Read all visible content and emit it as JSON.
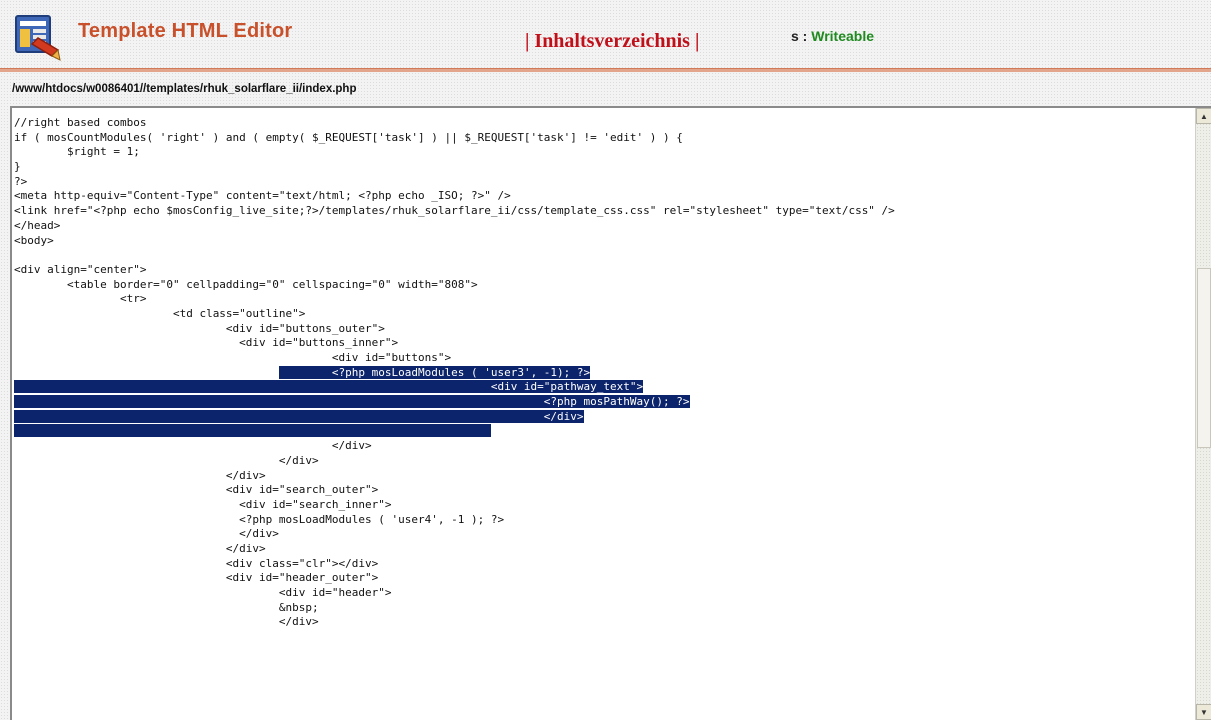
{
  "header": {
    "title": "Template HTML Editor",
    "toc_link": "| Inhaltsverzeichnis |",
    "status_key": "s :",
    "status_value": "Writeable",
    "logo_icon": "template-editor-icon"
  },
  "colors": {
    "title": "#c8502a",
    "toc_link": "#c0101a",
    "status_value": "#1f8a1f",
    "selection": "#0c246b"
  },
  "file": {
    "path": "/www/htdocs/w0086401//templates/rhuk_solarflare_ii/index.php"
  },
  "editor": {
    "scroll_up_icon": "scroll-up-arrow-icon",
    "scroll_down_icon": "scroll-down-arrow-icon",
    "lines": [
      {
        "indent": "",
        "text": "//right based combos",
        "sel_pre": "",
        "sel_text": ""
      },
      {
        "indent": "",
        "text": "if ( mosCountModules( 'right' ) and ( empty( $_REQUEST['task'] ) || $_REQUEST['task'] != 'edit' ) ) {",
        "sel_pre": "",
        "sel_text": ""
      },
      {
        "indent": "        ",
        "text": "$right = 1;",
        "sel_pre": "",
        "sel_text": ""
      },
      {
        "indent": "",
        "text": "}",
        "sel_pre": "",
        "sel_text": ""
      },
      {
        "indent": "",
        "text": "?>",
        "sel_pre": "",
        "sel_text": ""
      },
      {
        "indent": "",
        "text": "<meta http-equiv=\"Content-Type\" content=\"text/html; <?php echo _ISO; ?>\" />",
        "sel_pre": "",
        "sel_text": ""
      },
      {
        "indent": "",
        "text": "<link href=\"<?php echo $mosConfig_live_site;?>/templates/rhuk_solarflare_ii/css/template_css.css\" rel=\"stylesheet\" type=\"text/css\" />",
        "sel_pre": "",
        "sel_text": ""
      },
      {
        "indent": "",
        "text": "</head>",
        "sel_pre": "",
        "sel_text": ""
      },
      {
        "indent": "",
        "text": "<body>",
        "sel_pre": "",
        "sel_text": ""
      },
      {
        "indent": "",
        "text": "",
        "sel_pre": "",
        "sel_text": ""
      },
      {
        "indent": "",
        "text": "<div align=\"center\">",
        "sel_pre": "",
        "sel_text": ""
      },
      {
        "indent": "        ",
        "text": "<table border=\"0\" cellpadding=\"0\" cellspacing=\"0\" width=\"808\">",
        "sel_pre": "",
        "sel_text": ""
      },
      {
        "indent": "                ",
        "text": "<tr>",
        "sel_pre": "",
        "sel_text": ""
      },
      {
        "indent": "                        ",
        "text": "<td class=\"outline\">",
        "sel_pre": "",
        "sel_text": ""
      },
      {
        "indent": "                                ",
        "text": "<div id=\"buttons_outer\">",
        "sel_pre": "",
        "sel_text": ""
      },
      {
        "indent": "                                  ",
        "text": "<div id=\"buttons_inner\">",
        "sel_pre": "",
        "sel_text": ""
      },
      {
        "indent": "                                                ",
        "text": "<div id=\"buttons\">",
        "sel_pre": "",
        "sel_text": ""
      },
      {
        "indent": "                                        ",
        "text": "",
        "sel_pre": "        ",
        "sel_text": "<?php mosLoadModules ( 'user3', -1); ?>"
      },
      {
        "indent": "",
        "text": "",
        "sel_pre": "",
        "sel_text": "                                                                        <div id=\"pathway_text\">"
      },
      {
        "indent": "",
        "text": "",
        "sel_pre": "",
        "sel_text": "                                                                                <?php mosPathWay(); ?>"
      },
      {
        "indent": "",
        "text": "",
        "sel_pre": "",
        "sel_text": "                                                                                </div>"
      },
      {
        "indent": "",
        "text": "",
        "sel_pre": "",
        "sel_text": "                                                                        "
      },
      {
        "indent": "                                                ",
        "text": "</div>",
        "sel_pre": "",
        "sel_text": ""
      },
      {
        "indent": "                                        ",
        "text": "</div>",
        "sel_pre": "",
        "sel_text": ""
      },
      {
        "indent": "                                ",
        "text": "</div>",
        "sel_pre": "",
        "sel_text": ""
      },
      {
        "indent": "                                ",
        "text": "<div id=\"search_outer\">",
        "sel_pre": "",
        "sel_text": ""
      },
      {
        "indent": "                                  ",
        "text": "<div id=\"search_inner\">",
        "sel_pre": "",
        "sel_text": ""
      },
      {
        "indent": "                                  ",
        "text": "<?php mosLoadModules ( 'user4', -1 ); ?>",
        "sel_pre": "",
        "sel_text": ""
      },
      {
        "indent": "                                  ",
        "text": "</div>",
        "sel_pre": "",
        "sel_text": ""
      },
      {
        "indent": "                                ",
        "text": "</div>",
        "sel_pre": "",
        "sel_text": ""
      },
      {
        "indent": "                                ",
        "text": "<div class=\"clr\"></div>",
        "sel_pre": "",
        "sel_text": ""
      },
      {
        "indent": "                                ",
        "text": "<div id=\"header_outer\">",
        "sel_pre": "",
        "sel_text": ""
      },
      {
        "indent": "                                        ",
        "text": "<div id=\"header\">",
        "sel_pre": "",
        "sel_text": ""
      },
      {
        "indent": "                                        ",
        "text": "&nbsp;",
        "sel_pre": "",
        "sel_text": ""
      },
      {
        "indent": "                                        ",
        "text": "</div>",
        "sel_pre": "",
        "sel_text": ""
      }
    ]
  }
}
